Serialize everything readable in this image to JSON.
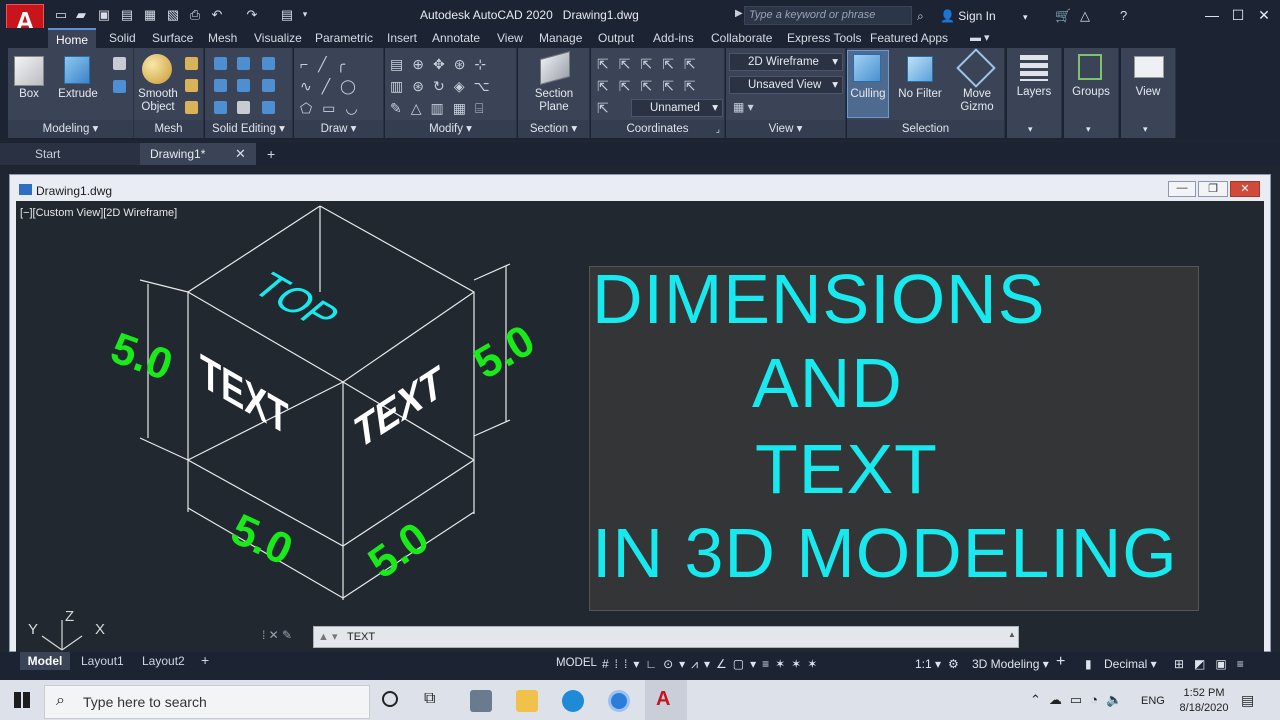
{
  "titlebar": {
    "app": "Autodesk AutoCAD 2020",
    "document": "Drawing1.dwg",
    "search_placeholder": "Type a keyword or phrase",
    "sign_in": "Sign In",
    "logo_letter": "A"
  },
  "ribbon_tabs": [
    "Home",
    "Solid",
    "Surface",
    "Mesh",
    "Visualize",
    "Parametric",
    "Insert",
    "Annotate",
    "View",
    "Manage",
    "Output",
    "Add-ins",
    "Collaborate",
    "Express Tools",
    "Featured Apps"
  ],
  "panels": {
    "modeling": {
      "label": "Modeling",
      "box": "Box",
      "extrude": "Extrude"
    },
    "mesh": {
      "label": "Mesh",
      "smooth": "Smooth",
      "object": "Object"
    },
    "solid_editing": {
      "label": "Solid Editing"
    },
    "draw": {
      "label": "Draw"
    },
    "modify": {
      "label": "Modify"
    },
    "section": {
      "label": "Section",
      "btn1": "Section",
      "btn2": "Plane"
    },
    "coordinates": {
      "label": "Coordinates",
      "ucs": "Unnamed"
    },
    "view": {
      "label": "View",
      "visual_style": "2D Wireframe",
      "view": "Unsaved View"
    },
    "selection": {
      "label": "Selection",
      "culling": "Culling",
      "filter": "No Filter",
      "gizmo1": "Move",
      "gizmo2": "Gizmo"
    },
    "layers": {
      "label": "Layers"
    },
    "groups": {
      "label": "Groups"
    },
    "viewbtn": {
      "label": "View"
    }
  },
  "file_tabs": {
    "start": "Start",
    "drawing": "Drawing1*"
  },
  "doc": {
    "title": "Drawing1.dwg",
    "view_label": "[−][Custom View][2D Wireframe]"
  },
  "drawing": {
    "dim": "5.0",
    "top_text": "TOP",
    "face_text": "TEXT",
    "axis_x": "X",
    "axis_y": "Y",
    "axis_z": "Z"
  },
  "headline": {
    "line1": "DIMENSIONS",
    "line2": "AND",
    "line3": "TEXT",
    "line4": "IN 3D MODELING"
  },
  "command": {
    "text": "TEXT"
  },
  "layout_tabs": {
    "model": "Model",
    "layout1": "Layout1",
    "layout2": "Layout2"
  },
  "status": {
    "model": "MODEL",
    "scale": "1:1",
    "workspace": "3D Modeling",
    "units": "Decimal"
  },
  "taskbar": {
    "search": "Type here to search",
    "lang": "ENG",
    "time": "1:52 PM",
    "date": "8/18/2020"
  }
}
